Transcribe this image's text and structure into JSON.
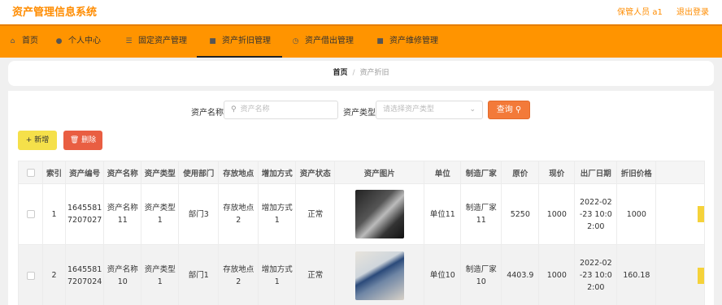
{
  "header": {
    "title": "资产管理信息系统",
    "user_label": "保管人员 a1",
    "logout_label": "退出登录"
  },
  "nav": {
    "items": [
      {
        "label": "首页",
        "icon": "home-icon"
      },
      {
        "label": "个人中心",
        "icon": "user-icon"
      },
      {
        "label": "固定资产管理",
        "icon": "list-icon"
      },
      {
        "label": "资产折旧管理",
        "icon": "folder-icon"
      },
      {
        "label": "资产借出管理",
        "icon": "clock-icon"
      },
      {
        "label": "资产维修管理",
        "icon": "folder-icon"
      }
    ],
    "active_index": 3
  },
  "breadcrumb": {
    "home": "首页",
    "separator": "/",
    "current": "资产折旧"
  },
  "search": {
    "name_label": "资产名称",
    "name_placeholder": "资产名称",
    "type_label": "资产类型",
    "type_placeholder": "请选择资产类型",
    "query_label": "查询"
  },
  "actions": {
    "add_label": "新增",
    "delete_label": "删除"
  },
  "table": {
    "columns": [
      "索引",
      "资产编号",
      "资产名称",
      "资产类型",
      "使用部门",
      "存放地点",
      "增加方式",
      "资产状态",
      "资产图片",
      "单位",
      "制造厂家",
      "原价",
      "现价",
      "出厂日期",
      "折旧价格"
    ],
    "rows": [
      {
        "index": "1",
        "asset_no": "16455817207027",
        "asset_no_l1": "1645581",
        "asset_no_l2": "7207027",
        "name_l1": "资产名称",
        "name_l2": "11",
        "type_l1": "资产类型",
        "type_l2": "1",
        "dept": "部门3",
        "loc_l1": "存放地点",
        "loc_l2": "2",
        "method_l1": "增加方式",
        "method_l2": "1",
        "status": "正常",
        "unit": "单位11",
        "maker_l1": "制造厂家",
        "maker_l2": "11",
        "orig_price": "5250",
        "cur_price": "1000",
        "date_l1": "2022-02",
        "date_l2": "-23 10:0",
        "date_l3": "2:00",
        "dep_price": "1000"
      },
      {
        "index": "2",
        "asset_no": "16455817207024",
        "asset_no_l1": "1645581",
        "asset_no_l2": "7207024",
        "name_l1": "资产名称",
        "name_l2": "10",
        "type_l1": "资产类型",
        "type_l2": "1",
        "dept": "部门1",
        "loc_l1": "存放地点",
        "loc_l2": "2",
        "method_l1": "增加方式",
        "method_l2": "1",
        "status": "正常",
        "unit": "单位10",
        "maker_l1": "制造厂家",
        "maker_l2": "10",
        "orig_price": "4403.9",
        "cur_price": "1000",
        "date_l1": "2022-02",
        "date_l2": "-23 10:0",
        "date_l3": "2:00",
        "dep_price": "160.18"
      }
    ]
  },
  "colors": {
    "accent": "#ff9400",
    "title": "#ff8c00",
    "query_button": "#f37a39",
    "add_button": "#f5e04a",
    "delete_button": "#e95e42"
  }
}
